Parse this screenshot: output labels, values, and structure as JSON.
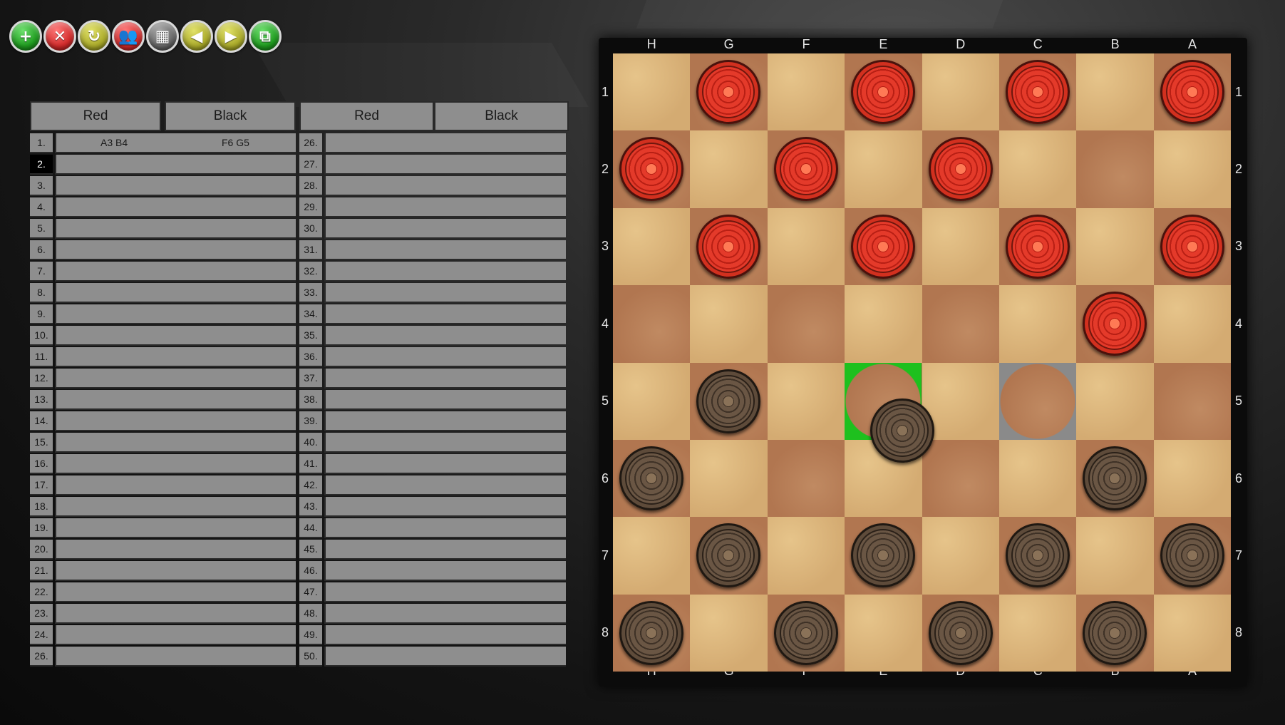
{
  "toolbar": {
    "buttons": [
      {
        "name": "new-game-button",
        "icon": "plus-icon",
        "glyph": "+",
        "color": "green"
      },
      {
        "name": "close-button",
        "icon": "close-icon",
        "glyph": "✕",
        "color": "red"
      },
      {
        "name": "restart-button",
        "icon": "refresh-icon",
        "glyph": "↻",
        "color": "olive"
      },
      {
        "name": "players-button",
        "icon": "players-icon",
        "glyph": "👥",
        "color": "red"
      },
      {
        "name": "board-button",
        "icon": "grid-icon",
        "glyph": "▦",
        "color": "gray"
      },
      {
        "name": "undo-button",
        "icon": "arrow-left-icon",
        "glyph": "◀",
        "color": "olive"
      },
      {
        "name": "redo-button",
        "icon": "arrow-right-icon",
        "glyph": "▶",
        "color": "olive"
      },
      {
        "name": "network-button",
        "icon": "network-icon",
        "glyph": "⧉",
        "color": "green"
      }
    ]
  },
  "notation": {
    "headers": [
      "Red",
      "Black",
      "Red",
      "Black"
    ],
    "left_numbers": [
      "1.",
      "2.",
      "3.",
      "4.",
      "5.",
      "6.",
      "7.",
      "8.",
      "9.",
      "10.",
      "11.",
      "12.",
      "13.",
      "14.",
      "15.",
      "16.",
      "17.",
      "18.",
      "19.",
      "20.",
      "21.",
      "22.",
      "23.",
      "24.",
      "26."
    ],
    "right_numbers": [
      "26.",
      "27.",
      "28.",
      "29.",
      "30.",
      "31.",
      "32.",
      "33.",
      "34.",
      "35.",
      "36.",
      "37.",
      "38.",
      "39.",
      "40.",
      "41.",
      "42.",
      "43.",
      "44.",
      "45.",
      "46.",
      "47.",
      "48.",
      "49.",
      "50."
    ],
    "active_index": 1,
    "moves": [
      {
        "red": "A3 B4",
        "black": "F6 G5"
      }
    ]
  },
  "board": {
    "files": [
      "H",
      "G",
      "F",
      "E",
      "D",
      "C",
      "B",
      "A"
    ],
    "ranks": [
      "1",
      "2",
      "3",
      "4",
      "5",
      "6",
      "7",
      "8"
    ],
    "pieces": [
      {
        "color": "red",
        "square": "G1"
      },
      {
        "color": "red",
        "square": "E1"
      },
      {
        "color": "red",
        "square": "C1"
      },
      {
        "color": "red",
        "square": "A1"
      },
      {
        "color": "red",
        "square": "H2"
      },
      {
        "color": "red",
        "square": "F2"
      },
      {
        "color": "red",
        "square": "D2"
      },
      {
        "color": "red",
        "square": "G3"
      },
      {
        "color": "red",
        "square": "E3"
      },
      {
        "color": "red",
        "square": "C3"
      },
      {
        "color": "red",
        "square": "A3"
      },
      {
        "color": "red",
        "square": "B4"
      },
      {
        "color": "black",
        "square": "G5"
      },
      {
        "color": "black",
        "square": "H6"
      },
      {
        "color": "black",
        "square": "B6"
      },
      {
        "color": "black",
        "square": "G7"
      },
      {
        "color": "black",
        "square": "E7"
      },
      {
        "color": "black",
        "square": "C7"
      },
      {
        "color": "black",
        "square": "A7"
      },
      {
        "color": "black",
        "square": "H8"
      },
      {
        "color": "black",
        "square": "F8"
      },
      {
        "color": "black",
        "square": "D8"
      },
      {
        "color": "black",
        "square": "B8"
      }
    ],
    "dragging": {
      "color": "black",
      "from": "F6"
    },
    "highlights": [
      {
        "square": "E5",
        "color": "#1ec01e"
      },
      {
        "square": "C5",
        "color": "#8a8a8a"
      }
    ]
  }
}
